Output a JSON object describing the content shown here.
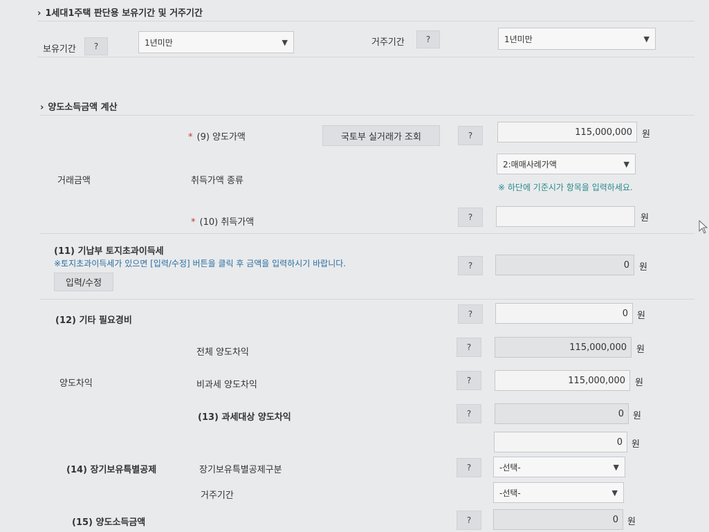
{
  "section1": {
    "title": "1세대1주택 판단용 보유기간 및 거주기간",
    "holding_label": "보유기간",
    "holding_value": "1년미만",
    "residence_label": "거주기간",
    "residence_value": "1년미만"
  },
  "section2": {
    "title": "양도소득금액 계산",
    "trade_amount_label": "거래금액",
    "sale_price_label": "(9) 양도가액",
    "lookup_button": "국토부 실거래가 조회",
    "sale_price_value": "115,000,000",
    "acq_type_label": "취득가액 종류",
    "acq_type_value": "2:매매사례가액",
    "acq_type_note": "※ 하단에 기준시가 항목을 입력하세요.",
    "acq_price_label": "(10) 취득가액",
    "acq_price_value": "",
    "land_tax_label": "(11) 기납부 토지초과이득세",
    "land_tax_note": "※토지초과이득세가 있으면 [입력/수정] 버튼을 클릭 후 금액을 입력하시기 바랍니다.",
    "edit_button": "입력/수정",
    "land_tax_value": "0",
    "other_expense_label": "(12) 기타 필요경비",
    "other_expense_value": "0",
    "gain_label": "양도차익",
    "total_gain_label": "전체 양도차익",
    "total_gain_value": "115,000,000",
    "nontax_gain_label": "비과세 양도차익",
    "nontax_gain_value": "115,000,000",
    "taxable_gain_label": "(13) 과세대상 양도차익",
    "taxable_gain_value": "0",
    "extra_value": "0",
    "longterm_label": "(14) 장기보유특별공제",
    "longterm_type_label": "장기보유특별공제구분",
    "longterm_type_value": "-선택-",
    "longterm_res_label": "거주기간",
    "longterm_res_value": "-선택-",
    "income_label": "(15) 양도소득금액",
    "income_value": "0",
    "unit": "원",
    "q": "?",
    "req_mark": "*"
  }
}
